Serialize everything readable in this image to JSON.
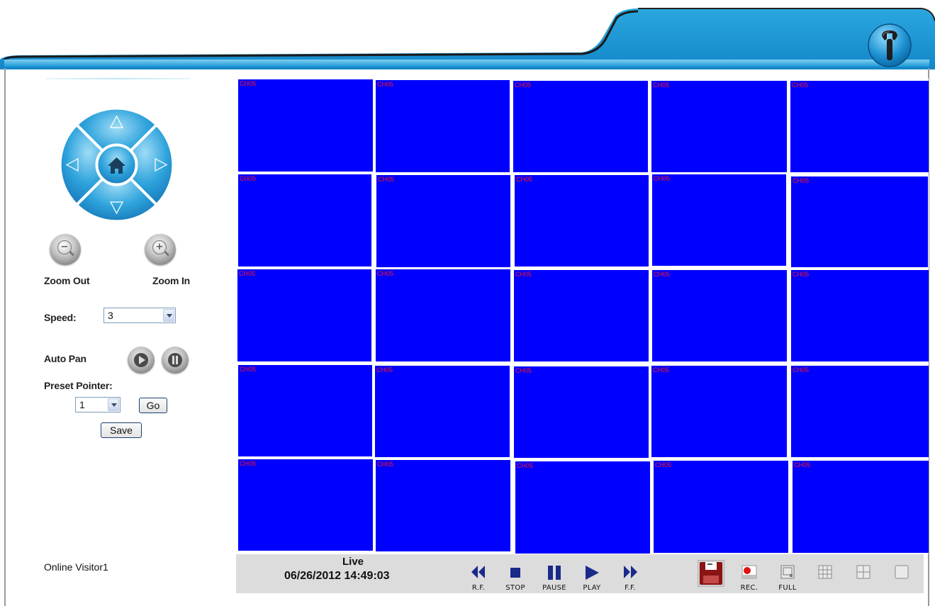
{
  "header": {
    "settings_icon": "wrench-icon",
    "accent_color": "#1e9ad6"
  },
  "ptz": {
    "icons": [
      "arrow-up-icon",
      "arrow-down-icon",
      "arrow-left-icon",
      "arrow-right-icon",
      "home-icon"
    ],
    "color": "#29a3dc"
  },
  "zoom": {
    "out_label": "Zoom Out",
    "in_label": "Zoom In"
  },
  "speed": {
    "label": "Speed:",
    "value": "3"
  },
  "auto_pan": {
    "label": "Auto Pan"
  },
  "preset": {
    "label": "Preset Pointer:",
    "value": "1",
    "go_label": "Go",
    "save_label": "Save"
  },
  "footer": {
    "online_visitor": "Online Visitor1"
  },
  "grid": {
    "channel_label": "CH05",
    "cell_color": "#0000ff",
    "label_color": "#ff1a1a",
    "rows": 5,
    "cols": 5
  },
  "toolbar": {
    "live_label": "Live",
    "datetime": "06/26/2012 14:49:03",
    "rf_label": "R.F.",
    "stop_label": "STOP",
    "pause_label": "PAUSE",
    "play_label": "PLAY",
    "ff_label": "F.F.",
    "rec_label": "REC.",
    "full_label": "FULL",
    "icons": [
      "save-icon",
      "record-icon",
      "fullscreen-icon",
      "grid-9-icon",
      "grid-4-icon",
      "single-view-icon"
    ]
  }
}
